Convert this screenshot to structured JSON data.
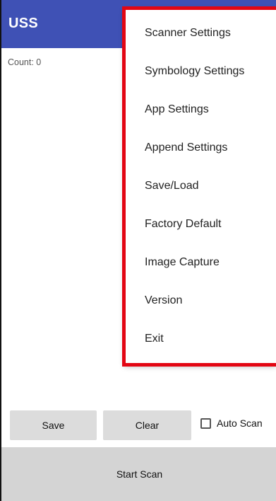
{
  "app_bar": {
    "title": "USS",
    "color": "#3f51b5"
  },
  "main": {
    "count_text": "Count: 0"
  },
  "buttons": {
    "save": "Save",
    "clear": "Clear",
    "start_scan": "Start Scan"
  },
  "auto_scan": {
    "label": "Auto Scan",
    "checked": false
  },
  "overflow_menu": {
    "items": [
      "Scanner Settings",
      "Symbology Settings",
      "App Settings",
      "Append Settings",
      "Save/Load",
      "Factory Default",
      "Image Capture",
      "Version",
      "Exit"
    ]
  },
  "annotation": {
    "highlight_color": "#e30613"
  }
}
